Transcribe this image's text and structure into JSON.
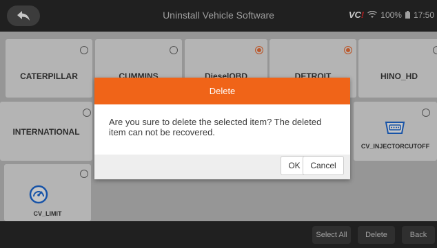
{
  "header": {
    "title": "Uninstall Vehicle Software",
    "vci_label": "VC",
    "wifi_icon": "wifi-icon",
    "battery_text": "100%",
    "battery_icon": "battery-icon",
    "time": "17:50"
  },
  "tiles": [
    {
      "label": "CATERPILLAR",
      "checked": false
    },
    {
      "label": "CUMMINS",
      "checked": false
    },
    {
      "label": "DieselOBD",
      "checked": true
    },
    {
      "label": "DETROIT",
      "checked": true
    },
    {
      "label": "HINO_HD",
      "checked": false
    },
    {
      "label": "INTERNATIONAL",
      "checked": false
    },
    {
      "label": "CV_INJECTORCUTOFF",
      "checked": false,
      "icon": "obd-connector-icon"
    },
    {
      "label": "CV_LIMIT",
      "checked": false,
      "icon": "gauge-icon"
    }
  ],
  "bottom_bar": {
    "select_all": "Select All",
    "delete": "Delete",
    "back": "Back"
  },
  "dialog": {
    "title": "Delete",
    "message": "Are you sure to delete the selected item? The deleted item can not be recovered.",
    "ok": "OK",
    "cancel": "Cancel"
  },
  "colors": {
    "accent": "#f06418",
    "checked": "#f0723a",
    "bar": "#2a2a2a"
  }
}
